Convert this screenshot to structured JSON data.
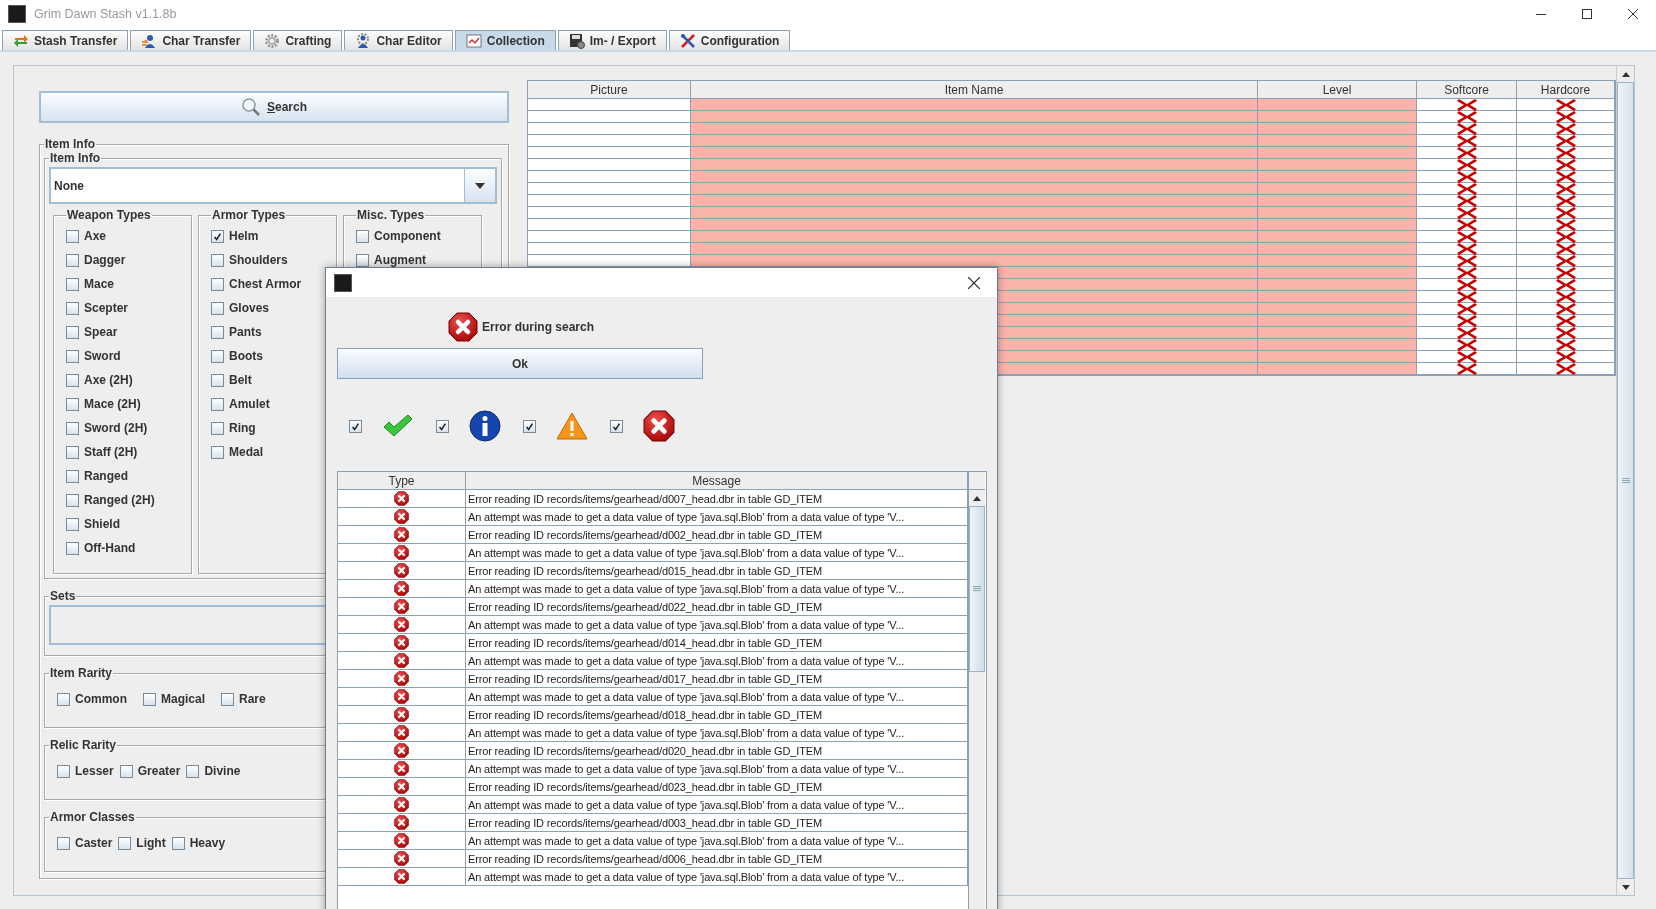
{
  "window": {
    "title": "Grim Dawn Stash v1.1.8b"
  },
  "tabs": [
    {
      "label": "Stash Transfer",
      "selected": false
    },
    {
      "label": "Char Transfer",
      "selected": false
    },
    {
      "label": "Crafting",
      "selected": false
    },
    {
      "label": "Char Editor",
      "selected": false
    },
    {
      "label": "Collection",
      "selected": true
    },
    {
      "label": "Im- / Export",
      "selected": false
    },
    {
      "label": "Configuration",
      "selected": false
    }
  ],
  "search_button": {
    "label": "Search"
  },
  "item_info": {
    "title": "Item Info",
    "inner_title": "Item Info",
    "dropdown": {
      "value": "None"
    },
    "groups": [
      {
        "title": "Weapon Types",
        "options": [
          {
            "label": "Axe",
            "checked": false
          },
          {
            "label": "Dagger",
            "checked": false
          },
          {
            "label": "Mace",
            "checked": false
          },
          {
            "label": "Scepter",
            "checked": false
          },
          {
            "label": "Spear",
            "checked": false
          },
          {
            "label": "Sword",
            "checked": false
          },
          {
            "label": "Axe (2H)",
            "checked": false
          },
          {
            "label": "Mace (2H)",
            "checked": false
          },
          {
            "label": "Sword (2H)",
            "checked": false
          },
          {
            "label": "Staff (2H)",
            "checked": false
          },
          {
            "label": "Ranged",
            "checked": false
          },
          {
            "label": "Ranged (2H)",
            "checked": false
          },
          {
            "label": "Shield",
            "checked": false
          },
          {
            "label": "Off-Hand",
            "checked": false
          }
        ]
      },
      {
        "title": "Armor Types",
        "options": [
          {
            "label": "Helm",
            "checked": true
          },
          {
            "label": "Shoulders",
            "checked": false
          },
          {
            "label": "Chest Armor",
            "checked": false
          },
          {
            "label": "Gloves",
            "checked": false
          },
          {
            "label": "Pants",
            "checked": false
          },
          {
            "label": "Boots",
            "checked": false
          },
          {
            "label": "Belt",
            "checked": false
          },
          {
            "label": "Amulet",
            "checked": false
          },
          {
            "label": "Ring",
            "checked": false
          },
          {
            "label": "Medal",
            "checked": false
          }
        ]
      },
      {
        "title": "Misc. Types",
        "options": [
          {
            "label": "Component",
            "checked": false
          },
          {
            "label": "Augment",
            "checked": false
          }
        ]
      }
    ],
    "sets": {
      "title": "Sets"
    },
    "filters": [
      {
        "title": "Item Rarity",
        "options": [
          {
            "label": "Common",
            "checked": false
          },
          {
            "label": "Magical",
            "checked": false
          },
          {
            "label": "Rare",
            "checked": false
          }
        ]
      },
      {
        "title": "Relic Rarity",
        "options": [
          {
            "label": "Lesser",
            "checked": false
          },
          {
            "label": "Greater",
            "checked": false
          },
          {
            "label": "Divine",
            "checked": false
          }
        ]
      },
      {
        "title": "Armor Classes",
        "options": [
          {
            "label": "Caster",
            "checked": false
          },
          {
            "label": "Light",
            "checked": false
          },
          {
            "label": "Heavy",
            "checked": false
          }
        ]
      }
    ]
  },
  "item_table": {
    "columns": [
      "Picture",
      "Item Name",
      "Level",
      "Softcore",
      "Hardcore"
    ],
    "rows": [
      {
        "softcore": false,
        "hardcore": false
      },
      {
        "softcore": false,
        "hardcore": false
      },
      {
        "softcore": false,
        "hardcore": false
      },
      {
        "softcore": false,
        "hardcore": false
      },
      {
        "softcore": false,
        "hardcore": false
      },
      {
        "softcore": false,
        "hardcore": false
      },
      {
        "softcore": false,
        "hardcore": false
      },
      {
        "softcore": false,
        "hardcore": false
      },
      {
        "softcore": false,
        "hardcore": false
      },
      {
        "softcore": false,
        "hardcore": false
      },
      {
        "softcore": false,
        "hardcore": false
      },
      {
        "softcore": false,
        "hardcore": false
      },
      {
        "softcore": false,
        "hardcore": false
      },
      {
        "softcore": false,
        "hardcore": false
      },
      {
        "softcore": false,
        "hardcore": false
      },
      {
        "softcore": false,
        "hardcore": false
      },
      {
        "softcore": false,
        "hardcore": false
      },
      {
        "softcore": false,
        "hardcore": false
      },
      {
        "softcore": false,
        "hardcore": false
      },
      {
        "softcore": false,
        "hardcore": false
      },
      {
        "softcore": false,
        "hardcore": false
      },
      {
        "softcore": false,
        "hardcore": false
      },
      {
        "softcore": false,
        "hardcore": false
      }
    ]
  },
  "dialog": {
    "message": "Error during search",
    "ok_button": "Ok",
    "filters": [
      {
        "kind": "success",
        "checked": true
      },
      {
        "kind": "info",
        "checked": true
      },
      {
        "kind": "warning",
        "checked": true
      },
      {
        "kind": "error",
        "checked": true
      }
    ],
    "log": {
      "columns": [
        "Type",
        "Message"
      ],
      "rows": [
        {
          "kind": "error",
          "message": "Error reading ID records/items/gearhead/d007_head.dbr in table GD_ITEM"
        },
        {
          "kind": "error",
          "message": "An attempt was made to get a data value of type 'java.sql.Blob' from a data value of type 'V..."
        },
        {
          "kind": "error",
          "message": "Error reading ID records/items/gearhead/d002_head.dbr in table GD_ITEM"
        },
        {
          "kind": "error",
          "message": "An attempt was made to get a data value of type 'java.sql.Blob' from a data value of type 'V..."
        },
        {
          "kind": "error",
          "message": "Error reading ID records/items/gearhead/d015_head.dbr in table GD_ITEM"
        },
        {
          "kind": "error",
          "message": "An attempt was made to get a data value of type 'java.sql.Blob' from a data value of type 'V..."
        },
        {
          "kind": "error",
          "message": "Error reading ID records/items/gearhead/d022_head.dbr in table GD_ITEM"
        },
        {
          "kind": "error",
          "message": "An attempt was made to get a data value of type 'java.sql.Blob' from a data value of type 'V..."
        },
        {
          "kind": "error",
          "message": "Error reading ID records/items/gearhead/d014_head.dbr in table GD_ITEM"
        },
        {
          "kind": "error",
          "message": "An attempt was made to get a data value of type 'java.sql.Blob' from a data value of type 'V..."
        },
        {
          "kind": "error",
          "message": "Error reading ID records/items/gearhead/d017_head.dbr in table GD_ITEM"
        },
        {
          "kind": "error",
          "message": "An attempt was made to get a data value of type 'java.sql.Blob' from a data value of type 'V..."
        },
        {
          "kind": "error",
          "message": "Error reading ID records/items/gearhead/d018_head.dbr in table GD_ITEM"
        },
        {
          "kind": "error",
          "message": "An attempt was made to get a data value of type 'java.sql.Blob' from a data value of type 'V..."
        },
        {
          "kind": "error",
          "message": "Error reading ID records/items/gearhead/d020_head.dbr in table GD_ITEM"
        },
        {
          "kind": "error",
          "message": "An attempt was made to get a data value of type 'java.sql.Blob' from a data value of type 'V..."
        },
        {
          "kind": "error",
          "message": "Error reading ID records/items/gearhead/d023_head.dbr in table GD_ITEM"
        },
        {
          "kind": "error",
          "message": "An attempt was made to get a data value of type 'java.sql.Blob' from a data value of type 'V..."
        },
        {
          "kind": "error",
          "message": "Error reading ID records/items/gearhead/d003_head.dbr in table GD_ITEM"
        },
        {
          "kind": "error",
          "message": "An attempt was made to get a data value of type 'java.sql.Blob' from a data value of type 'V..."
        },
        {
          "kind": "error",
          "message": "Error reading ID records/items/gearhead/d006_head.dbr in table GD_ITEM"
        },
        {
          "kind": "error",
          "message": "An attempt was made to get a data value of type 'java.sql.Blob' from a data value of type 'V..."
        }
      ]
    }
  }
}
